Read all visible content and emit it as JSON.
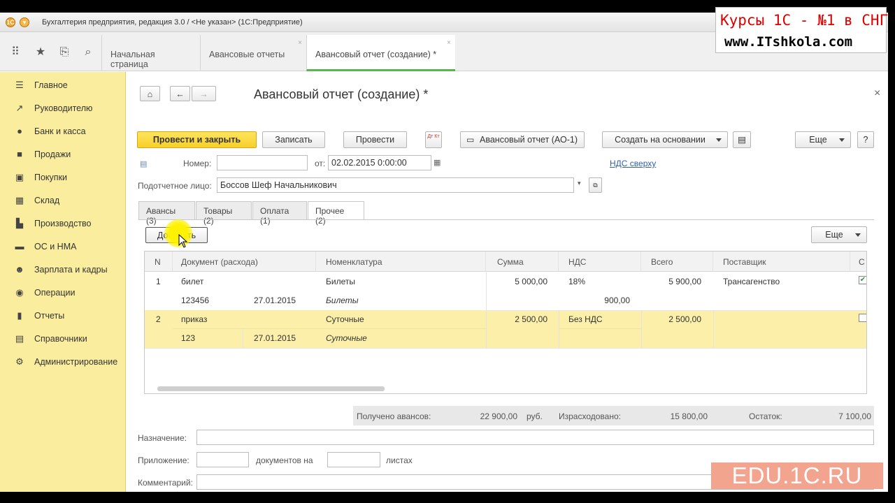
{
  "window": {
    "title": "Бухгалтерия предприятия, редакция 3.0 / <Не указан> (1С:Предприятие)"
  },
  "tabs": [
    {
      "label": "Начальная страница"
    },
    {
      "label": "Авансовые отчеты",
      "close": "×"
    },
    {
      "label": "Авансовый отчет (создание) *",
      "close": "×"
    }
  ],
  "sidebar": [
    {
      "label": "Главное",
      "icon": "menu-icon"
    },
    {
      "label": "Руководителю",
      "icon": "trend-icon"
    },
    {
      "label": "Банк и касса",
      "icon": "coin-icon"
    },
    {
      "label": "Продажи",
      "icon": "bag-icon"
    },
    {
      "label": "Покупки",
      "icon": "cart-icon"
    },
    {
      "label": "Склад",
      "icon": "grid-icon"
    },
    {
      "label": "Производство",
      "icon": "factory-icon"
    },
    {
      "label": "ОС и НМА",
      "icon": "truck-icon"
    },
    {
      "label": "Зарплата и кадры",
      "icon": "people-icon"
    },
    {
      "label": "Операции",
      "icon": "ops-icon"
    },
    {
      "label": "Отчеты",
      "icon": "bar-chart-icon"
    },
    {
      "label": "Справочники",
      "icon": "book-icon"
    },
    {
      "label": "Администрирование",
      "icon": "gear-icon"
    }
  ],
  "form": {
    "title": "Авансовый отчет (создание) *",
    "close": "×",
    "buttons": {
      "post_close": "Провести и закрыть",
      "save": "Записать",
      "post": "Провести",
      "dt_kt": "Дт Кт",
      "print": "Авансовый отчет (АО-1)",
      "create_based": "Создать на основании",
      "more": "Еще",
      "help": "?"
    },
    "number_label": "Номер:",
    "number_value": "",
    "date_label": "от:",
    "date_value": "02.02.2015  0:00:00",
    "vat_link": "НДС сверху",
    "person_label": "Подотчетное лицо:",
    "person_value": "Боссов Шеф Начальникович",
    "doc_tabs": [
      "Авансы (3)",
      "Товары (2)",
      "Оплата (1)",
      "Прочее (2)"
    ],
    "add_button": "Добавить",
    "table_more": "Еще",
    "columns": [
      "N",
      "Документ (расхода)",
      "Номенклатура",
      "Сумма",
      "НДС",
      "Всего",
      "Поставщик",
      "С"
    ],
    "rows": [
      {
        "n": "1",
        "doc": "билет",
        "doc_no": "123456",
        "doc_date": "27.01.2015",
        "item": "Билеты",
        "item2": "Билеты",
        "sum": "5 000,00",
        "vat": "18%",
        "vat_sum": "900,00",
        "total": "5 900,00",
        "supplier": "Трансагенство",
        "checked": true
      },
      {
        "n": "2",
        "doc": "приказ",
        "doc_no": "123",
        "doc_date": "27.01.2015",
        "item": "Суточные",
        "item2": "Суточные",
        "sum": "2 500,00",
        "vat": "Без НДС",
        "vat_sum": "",
        "total": "2 500,00",
        "supplier": "",
        "checked": false
      }
    ],
    "totals": {
      "received_label": "Получено авансов:",
      "received_value": "22 900,00",
      "currency": "руб.",
      "spent_label": "Израсходовано:",
      "spent_value": "15 800,00",
      "rest_label": "Остаток:",
      "rest_value": "7 100,00"
    },
    "purpose_label": "Назначение:",
    "purpose_value": "",
    "attach_label": "Приложение:",
    "attach_docs_label": "документов на",
    "attach_sheets_label": "листах",
    "comment_label": "Комментарий:",
    "comment_value": ""
  },
  "overlay": {
    "logo_line1": "Курсы 1С - №1 в СНГ",
    "logo_line2": "www.ITshkola.com",
    "edu": "EDU.1C.RU"
  },
  "colors": {
    "sidebar": "#fbed9e",
    "primary": "#f7cf2a",
    "selected_row": "#fbefaa",
    "active_tab": "#55b849"
  }
}
